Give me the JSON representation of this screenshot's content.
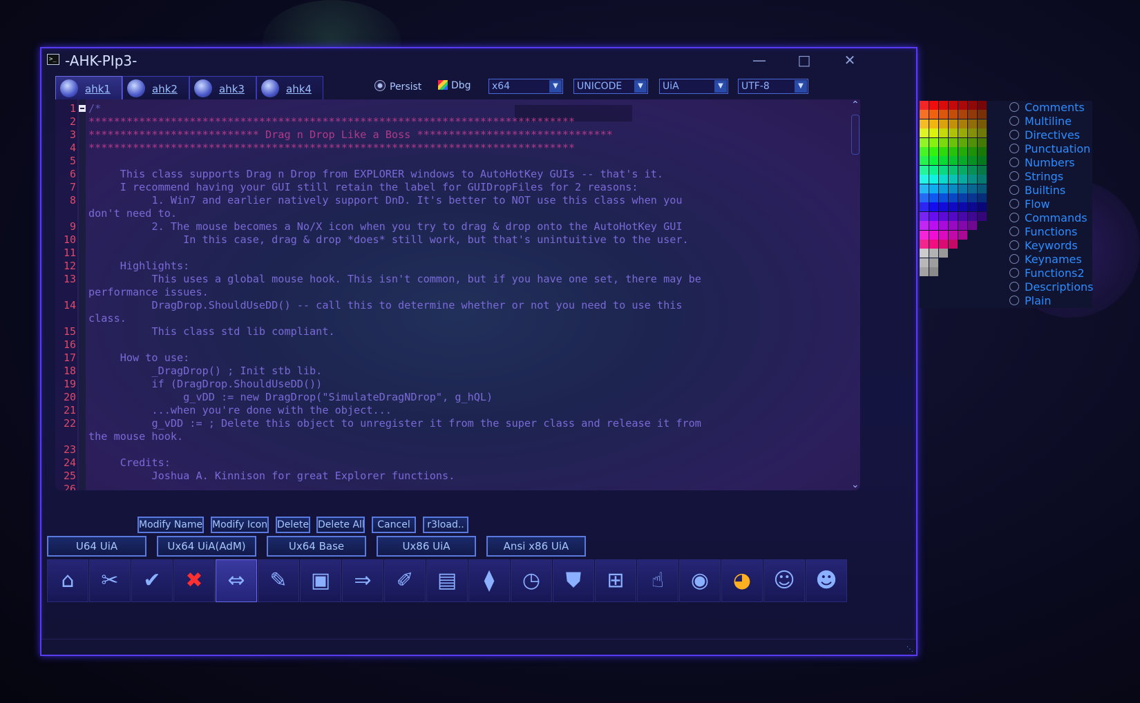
{
  "window": {
    "title": "-AHK-PIp3-"
  },
  "tabs": [
    {
      "label": "ahk1",
      "icon": "ahk1-clock-icon"
    },
    {
      "label": "ahk2",
      "icon": "ahk2-shield-icon"
    },
    {
      "label": "ahk3",
      "icon": "ahk3-orb-icon"
    },
    {
      "label": "ahk4",
      "icon": "ahk4-orb-icon"
    }
  ],
  "options": {
    "persist_label": "Persist",
    "dbg_label": "Dbg",
    "arch": "x64",
    "charset": "UNICODE",
    "access": "UiA",
    "encoding": "UTF-8"
  },
  "editor": {
    "line_numbers": [
      "1",
      "2",
      "3",
      "4",
      "5",
      "6",
      "7",
      "8",
      "",
      "9",
      "10",
      "11",
      "12",
      "13",
      "",
      "14",
      "",
      "15",
      "16",
      "17",
      "18",
      "19",
      "20",
      "21",
      "22",
      "",
      "23",
      "24",
      "25",
      "26"
    ],
    "lines": [
      "/*",
      "*****************************************************************************",
      "*************************** Drag n Drop Like a Boss *******************************",
      "*****************************************************************************",
      "",
      "\tThis class supports Drag n Drop from EXPLORER windows to AutoHotKey GUIs -- that's it.",
      "\tI recommend having your GUI still retain the label for GUIDropFiles for 2 reasons:",
      "\t\t1. Win7 and earlier natively support DnD. It's better to NOT use this class when you",
      "don't need to.",
      "\t\t2. The mouse becomes a No/X icon when you try to drag & drop onto the AutoHotKey GUI",
      "\t\t\tIn this case, drag & drop *does* still work, but that's unintuitive to the user.",
      "",
      "\tHighlights:",
      "\t\tThis uses a global mouse hook. This isn't common, but if you have one set, there may be",
      "performance issues.",
      "\t\tDragDrop.ShouldUseDD() -- call this to determine whether or not you need to use this",
      "class.",
      "\t\tThis class std lib compliant.",
      "",
      "\tHow to use:",
      "\t\t_DragDrop() ; Init stb lib.",
      "\t\tif (DragDrop.ShouldUseDD())",
      "\t\t\tg_vDD := new DragDrop(\"SimulateDragNDrop\", g_hQL)",
      "\t\t...when you're done with the object...",
      "\t\tg_vDD := ; Delete this object to unregister it from the super class and release it from",
      "the mouse hook.",
      "",
      "\tCredits:",
      "\t\tJoshua A. Kinnison for great Explorer functions.",
      ""
    ]
  },
  "buttons_row1": [
    {
      "label": "Modify Name"
    },
    {
      "label": "Modify Icon"
    },
    {
      "label": "Delete"
    },
    {
      "label": "Delete All"
    },
    {
      "label": "Cancel"
    },
    {
      "label": "r3load.."
    }
  ],
  "buttons_row2": [
    {
      "label": "U64 UiA"
    },
    {
      "label": "Ux64 UiA(AdM)"
    },
    {
      "label": "Ux64 Base"
    },
    {
      "label": "Ux86 UiA"
    },
    {
      "label": "Ansi x86 UiA"
    }
  ],
  "toolbar": [
    "home-icon",
    "scissors-icon",
    "check-icon",
    "close-red-x-icon",
    "resize-arrows-icon",
    "edit-pencil-icon",
    "window-save-icon",
    "move-window-icon",
    "syringe-icon",
    "pictures-icon",
    "dna-icon",
    "clock-icon",
    "shield-icon",
    "windows-logo-icon",
    "hand-pointer-icon",
    "orb-logo-icon",
    "color-wheel-icon",
    "face-one-icon",
    "face-two-icon"
  ],
  "legend": [
    "Comments",
    "Multiline",
    "Directives",
    "Punctuation",
    "Numbers",
    "Strings",
    "Builtins",
    "Flow",
    "Commands",
    "Functions",
    "Keywords",
    "Keynames",
    "Functions2",
    "Descriptions",
    "Plain"
  ],
  "colors": {
    "accent": "#5a3cf0",
    "legend_text": "#2e8cff",
    "line_numbers": "#e04a6a",
    "code_text": "#7a6ad8",
    "comment_stars": "#b03a8a"
  }
}
